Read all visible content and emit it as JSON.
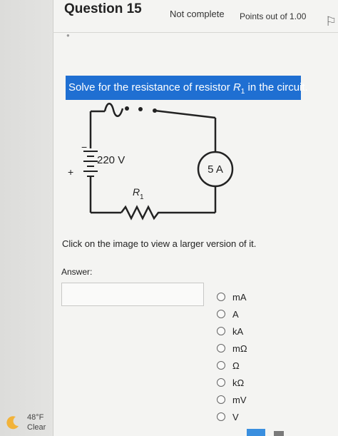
{
  "question": {
    "title": "Question 15",
    "status": "Not complete",
    "points": "Points out of 1.00"
  },
  "prompt": {
    "text_before": "Solve for the resistance of resistor ",
    "var": "R",
    "var_sub": "1",
    "text_after": " in the circuit."
  },
  "circuit": {
    "voltage_label": "220 V",
    "ammeter_label": "5 A",
    "resistor_label": "R",
    "resistor_sub": "1",
    "minus": "−",
    "plus": "+"
  },
  "hint": "Click on the image to view a larger version of it.",
  "answer": {
    "label": "Answer:",
    "value": "",
    "units": [
      "mA",
      "A",
      "kA",
      "mΩ",
      "Ω",
      "kΩ",
      "mV",
      "V"
    ]
  },
  "weather": {
    "temp": "48°F",
    "condition": "Clear"
  },
  "colors": {
    "prompt_bg": "#1f6fd2"
  }
}
